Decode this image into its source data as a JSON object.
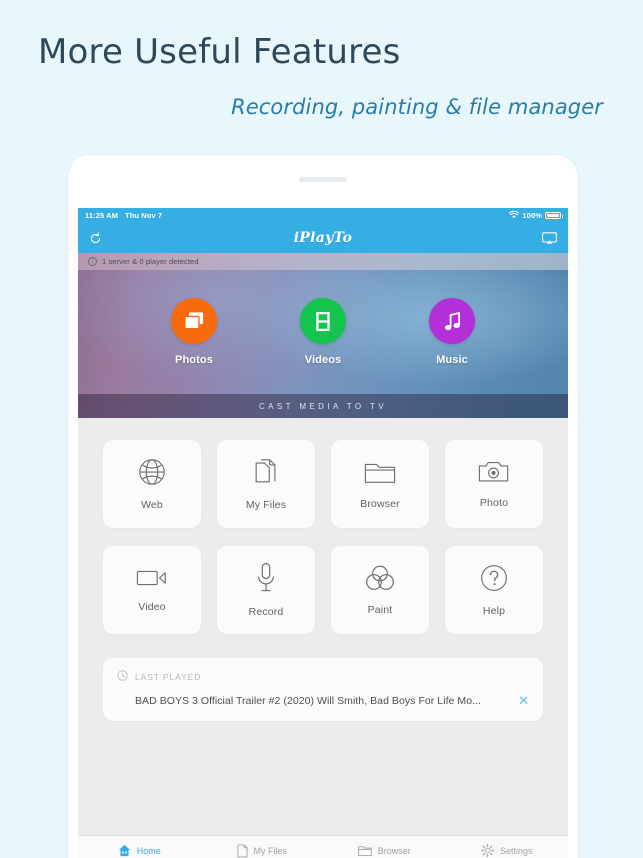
{
  "promo": {
    "headline": "More Useful Features",
    "subhead": "Recording, painting & file manager"
  },
  "colors": {
    "page_bg": "#e8f7fb",
    "headline": "#2e4a5a",
    "subhead": "#2b7ca8",
    "accent": "#35aee4",
    "photos": "#f96a0c",
    "videos": "#13c44d",
    "music": "#b32fd8",
    "tab_active": "#3aa9e8"
  },
  "status_bar": {
    "time": "11:25 AM",
    "date": "Thu Nov 7",
    "battery_percent": "100%",
    "wifi_icon": "wifi-icon",
    "battery_icon": "battery-full-icon"
  },
  "navbar": {
    "logo": "iPlayTo",
    "left_icon": "refresh-icon",
    "right_icon": "airplay-icon"
  },
  "notification": {
    "icon": "info-icon",
    "text": "1 server & 0 player detected"
  },
  "banner": {
    "caption": "CAST MEDIA TO TV",
    "items": [
      {
        "label": "Photos",
        "icon": "photos-icon",
        "color": "#f96a0c"
      },
      {
        "label": "Videos",
        "icon": "film-icon",
        "color": "#13c44d"
      },
      {
        "label": "Music",
        "icon": "music-note-icon",
        "color": "#b32fd8"
      }
    ]
  },
  "grid": {
    "tiles": [
      {
        "label": "Web",
        "icon": "globe-icon"
      },
      {
        "label": "My Files",
        "icon": "documents-icon"
      },
      {
        "label": "Browser",
        "icon": "folder-icon"
      },
      {
        "label": "Photo",
        "icon": "camera-icon"
      },
      {
        "label": "Video",
        "icon": "camcorder-icon"
      },
      {
        "label": "Record",
        "icon": "microphone-icon"
      },
      {
        "label": "Paint",
        "icon": "color-circles-icon"
      },
      {
        "label": "Help",
        "icon": "question-mark-icon"
      }
    ]
  },
  "last_played": {
    "header": "LAST PLAYED",
    "header_icon": "clock-icon",
    "title": "BAD BOYS 3 Official Trailer #2 (2020) Will Smith, Bad Boys For Life Mo...",
    "close_icon": "close-icon"
  },
  "tabbar": {
    "tabs": [
      {
        "label": "Home",
        "icon": "home-icon",
        "active": true
      },
      {
        "label": "My Files",
        "icon": "file-icon",
        "active": false
      },
      {
        "label": "Browser",
        "icon": "folder-icon",
        "active": false
      },
      {
        "label": "Settings",
        "icon": "gear-icon",
        "active": false
      }
    ]
  }
}
